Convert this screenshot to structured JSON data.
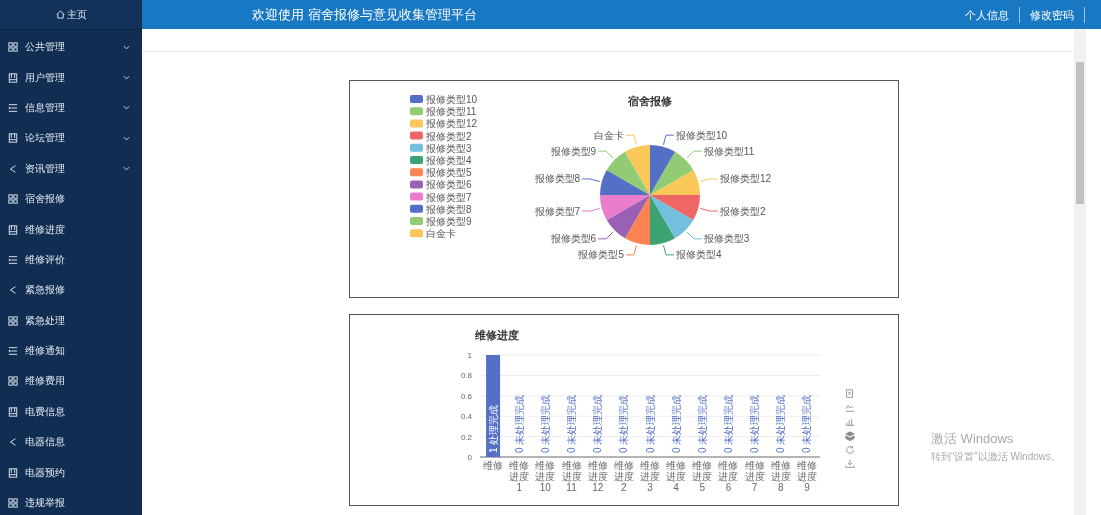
{
  "sidebar": {
    "home": "主页",
    "items": [
      {
        "label": "公共管理",
        "kind": "grid",
        "expandable": true
      },
      {
        "label": "用户管理",
        "kind": "book",
        "expandable": true
      },
      {
        "label": "信息管理",
        "kind": "list",
        "expandable": true
      },
      {
        "label": "论坛管理",
        "kind": "book",
        "expandable": true
      },
      {
        "label": "资讯管理",
        "kind": "share",
        "expandable": true
      },
      {
        "label": "宿舍报修",
        "kind": "grid",
        "expandable": false
      },
      {
        "label": "维修进度",
        "kind": "book",
        "expandable": false
      },
      {
        "label": "维修评价",
        "kind": "list",
        "expandable": false
      },
      {
        "label": "紧急报修",
        "kind": "share",
        "expandable": false
      },
      {
        "label": "紧急处理",
        "kind": "grid",
        "expandable": false
      },
      {
        "label": "维修通知",
        "kind": "list",
        "expandable": false
      },
      {
        "label": "维修费用",
        "kind": "grid",
        "expandable": false
      },
      {
        "label": "电费信息",
        "kind": "book",
        "expandable": false
      },
      {
        "label": "电器信息",
        "kind": "share",
        "expandable": false
      },
      {
        "label": "电器预约",
        "kind": "book",
        "expandable": false
      },
      {
        "label": "违规举报",
        "kind": "grid",
        "expandable": false
      }
    ]
  },
  "header": {
    "title": "欢迎使用 宿舍报修与意见收集管理平台",
    "links": [
      {
        "label": "个人信息"
      },
      {
        "label": "修改密码"
      }
    ]
  },
  "main": {
    "pie_card": {
      "title": "宿舍报修",
      "legend": [
        {
          "label": "报修类型10",
          "color": "#5470c6"
        },
        {
          "label": "报修类型11",
          "color": "#91cc75"
        },
        {
          "label": "报修类型12",
          "color": "#fac858"
        },
        {
          "label": "报修类型2",
          "color": "#ee6666"
        },
        {
          "label": "报修类型3",
          "color": "#73c0de"
        },
        {
          "label": "报修类型4",
          "color": "#3ba272"
        },
        {
          "label": "报修类型5",
          "color": "#fc8452"
        },
        {
          "label": "报修类型6",
          "color": "#9a60b4"
        },
        {
          "label": "报修类型7",
          "color": "#ea7ccc"
        },
        {
          "label": "报修类型8",
          "color": "#5470c6"
        },
        {
          "label": "报修类型9",
          "color": "#91cc75"
        },
        {
          "label": "白金卡",
          "color": "#fac858"
        }
      ],
      "slices": [
        {
          "label": "白金卡",
          "color": "#fac858"
        },
        {
          "label": "报修类型10",
          "color": "#5470c6"
        },
        {
          "label": "报修类型9",
          "color": "#91cc75"
        },
        {
          "label": "报修类型11",
          "color": "#91cc75"
        },
        {
          "label": "报修类型8",
          "color": "#5470c6"
        },
        {
          "label": "报修类型12",
          "color": "#fac858"
        },
        {
          "label": "报修类型7",
          "color": "#ea7ccc"
        },
        {
          "label": "报修类型2",
          "color": "#ee6666"
        },
        {
          "label": "报修类型6",
          "color": "#9a60b4"
        },
        {
          "label": "报修类型3",
          "color": "#73c0de"
        },
        {
          "label": "报修类型5",
          "color": "#fc8452"
        },
        {
          "label": "报修类型4",
          "color": "#3ba272"
        }
      ]
    },
    "bar_card": {
      "chart_data": {
        "type": "bar",
        "title": "维修进度",
        "grid": true,
        "categories": [
          "维修",
          "维修进度1",
          "维修进度10",
          "维修进度11",
          "维修进度12",
          "维修进度2",
          "维修进度3",
          "维修进度4",
          "维修进度5",
          "维修进度6",
          "维修进度7",
          "维修进度8",
          "维修进度9"
        ],
        "values": [
          1,
          0,
          0,
          0,
          0,
          0,
          0,
          0,
          0,
          0,
          0,
          0,
          0
        ],
        "ylim": [
          0,
          1
        ],
        "yticks": [
          0,
          0.2,
          0.4,
          0.6,
          0.8,
          1
        ],
        "value_labels": [
          "1 处理完成",
          "0 未处理完成",
          "0 未处理完成",
          "0 未处理完成",
          "0 未处理完成",
          "0 未处理完成",
          "0 未处理完成",
          "0 未处理完成",
          "0 未处理完成",
          "0 未处理完成",
          "0 未处理完成",
          "0 未处理完成",
          "0 未处理完成"
        ]
      },
      "toolbox": [
        {
          "kind": "data-view"
        },
        {
          "kind": "line"
        },
        {
          "kind": "bar"
        },
        {
          "kind": "stack"
        },
        {
          "kind": "restore"
        },
        {
          "kind": "save"
        }
      ]
    }
  },
  "os_notice": {
    "title": "激活 Windows",
    "text": "转到“设置”以激活 Windows。"
  }
}
